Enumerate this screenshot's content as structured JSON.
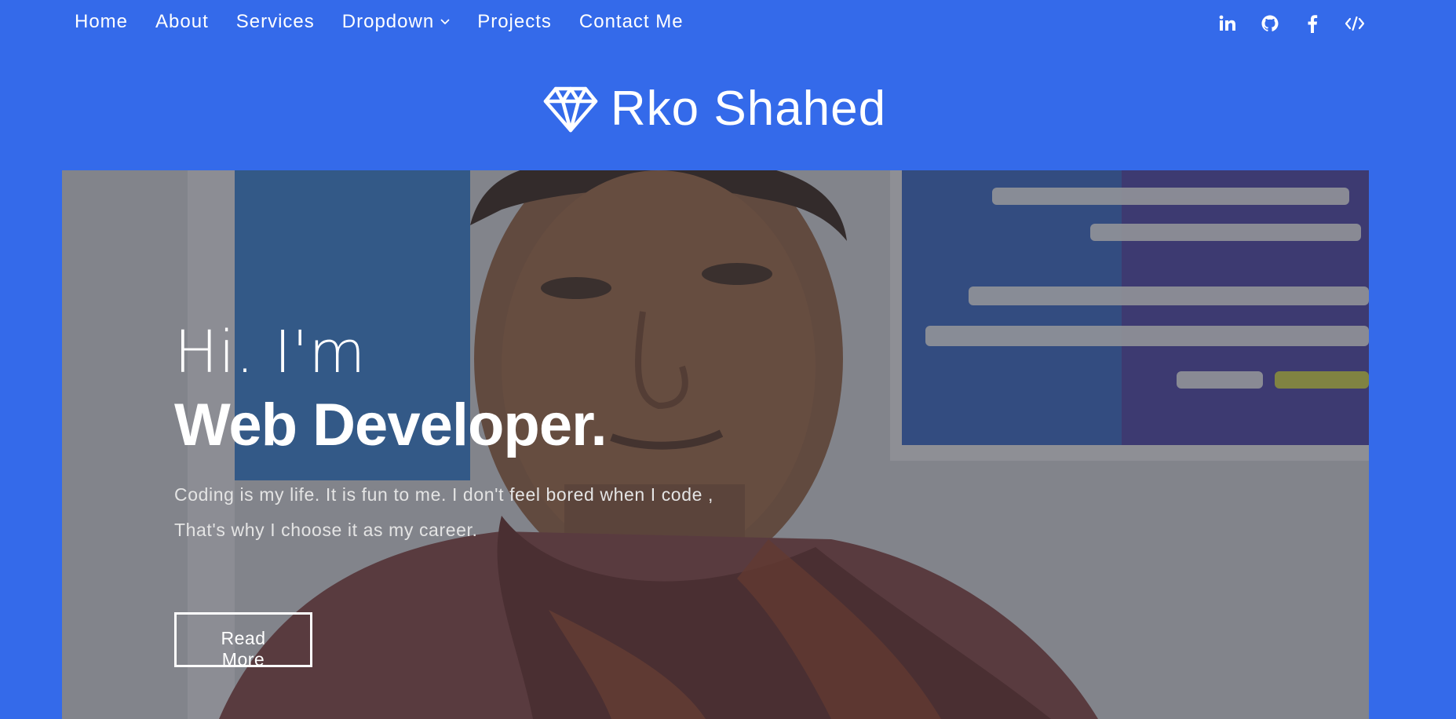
{
  "nav": {
    "links": [
      {
        "label": "Home"
      },
      {
        "label": "About"
      },
      {
        "label": "Services"
      },
      {
        "label": "Dropdown",
        "has_caret": true
      },
      {
        "label": "Projects"
      },
      {
        "label": "Contact Me"
      }
    ],
    "social": [
      {
        "name": "linkedin-icon"
      },
      {
        "name": "github-icon"
      },
      {
        "name": "facebook-icon"
      },
      {
        "name": "code-icon"
      }
    ]
  },
  "brand": {
    "icon": "diamond-icon",
    "name": "Rko Shahed"
  },
  "hero": {
    "greeting": "Hi. I'm",
    "title": "Web Developer.",
    "description_line1": "Coding is my life. It is fun to me. I don't feel bored when I code ,",
    "description_line2": "That's why I choose it as my career.",
    "button_label": "Read More"
  },
  "colors": {
    "background": "#346aea",
    "text": "#ffffff"
  }
}
